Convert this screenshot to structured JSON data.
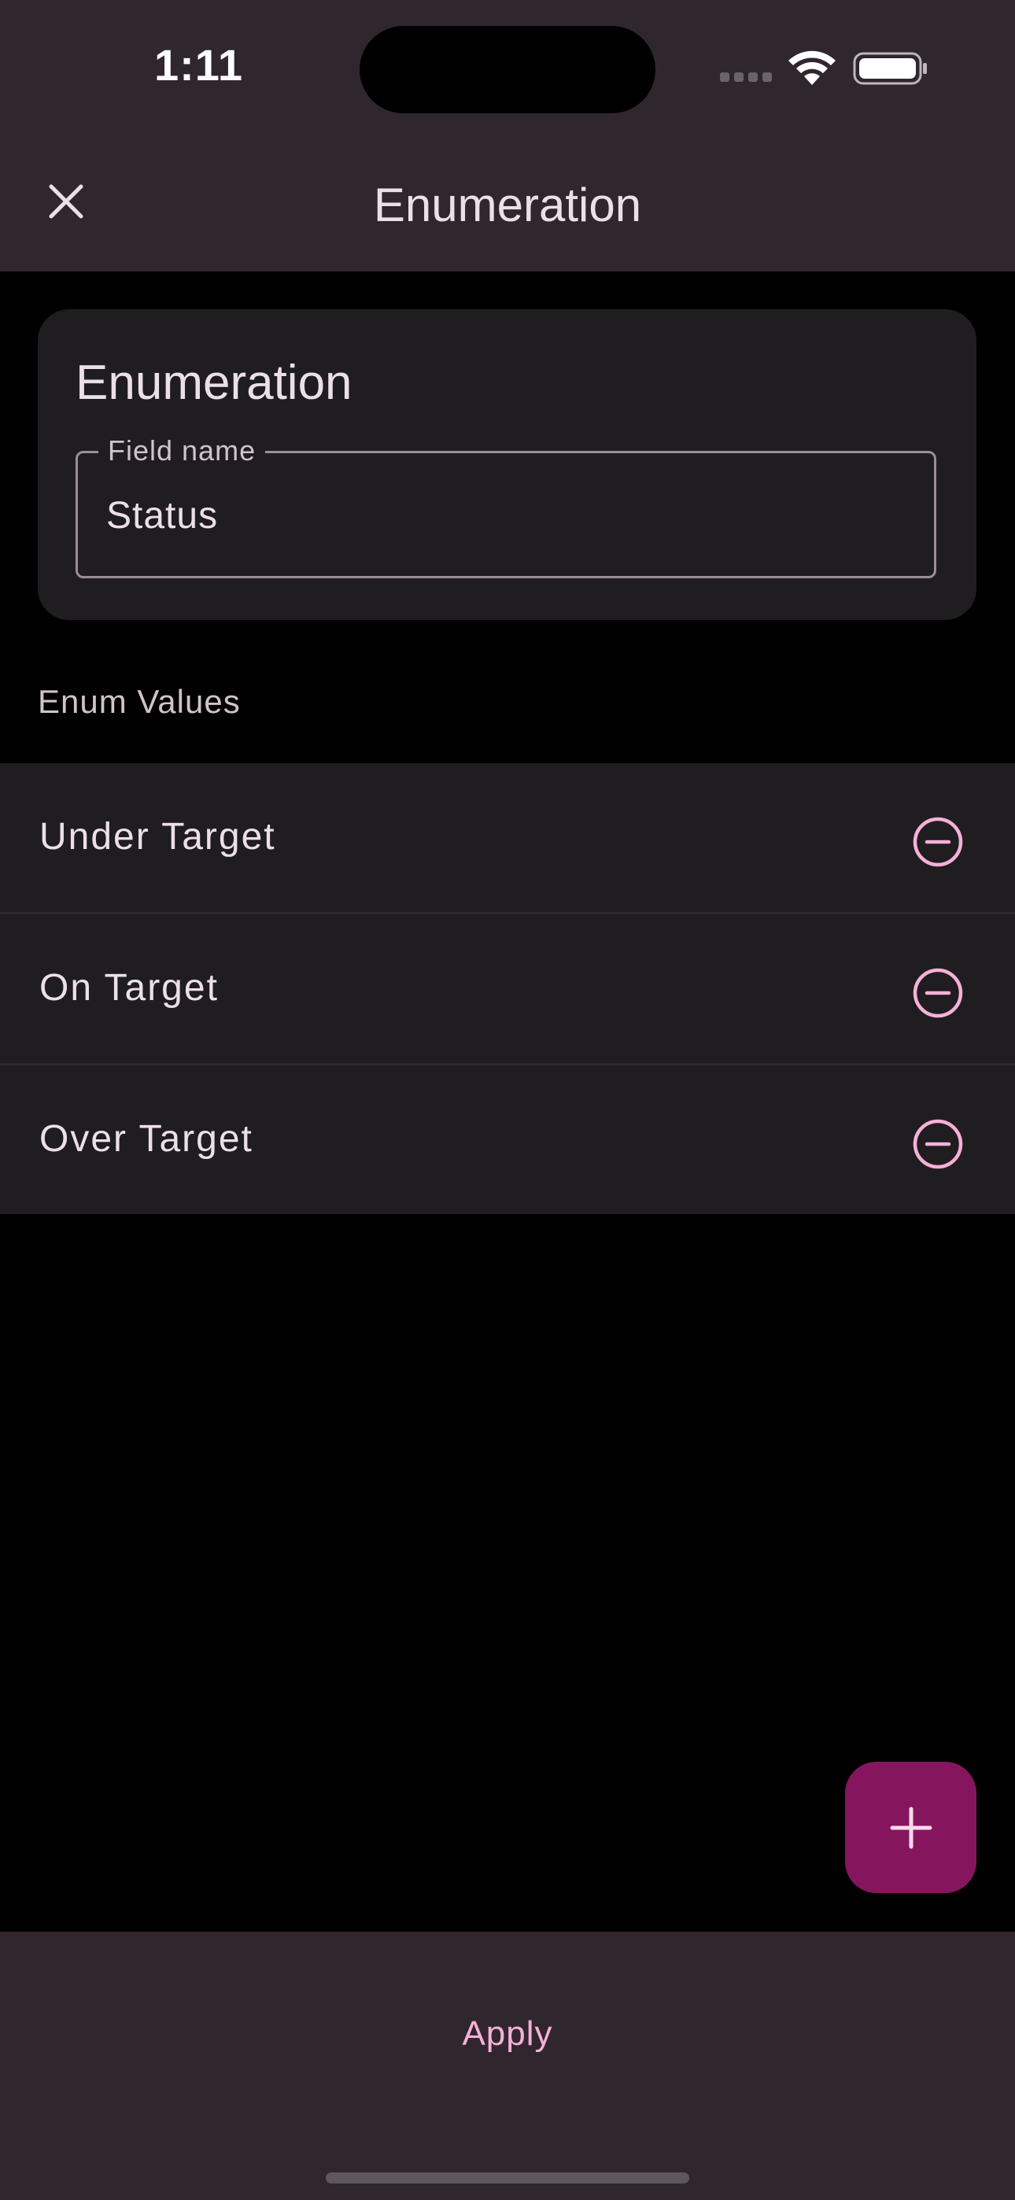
{
  "status_bar": {
    "time": "1:11"
  },
  "app_bar": {
    "title": "Enumeration",
    "close_icon": "close-icon"
  },
  "card": {
    "title": "Enumeration",
    "field": {
      "label": "Field name",
      "value": "Status"
    }
  },
  "enum_section": {
    "label": "Enum Values",
    "items": [
      {
        "label": "Under Target",
        "icon": "remove-circle-icon"
      },
      {
        "label": "On Target",
        "icon": "remove-circle-icon"
      },
      {
        "label": "Over Target",
        "icon": "remove-circle-icon"
      }
    ]
  },
  "fab": {
    "icon": "plus-icon"
  },
  "bottom_bar": {
    "apply_label": "Apply"
  },
  "colors": {
    "surface": "#30262e",
    "card": "#201d20",
    "accent_pink": "#f6b0d8",
    "fab": "#85165e"
  }
}
